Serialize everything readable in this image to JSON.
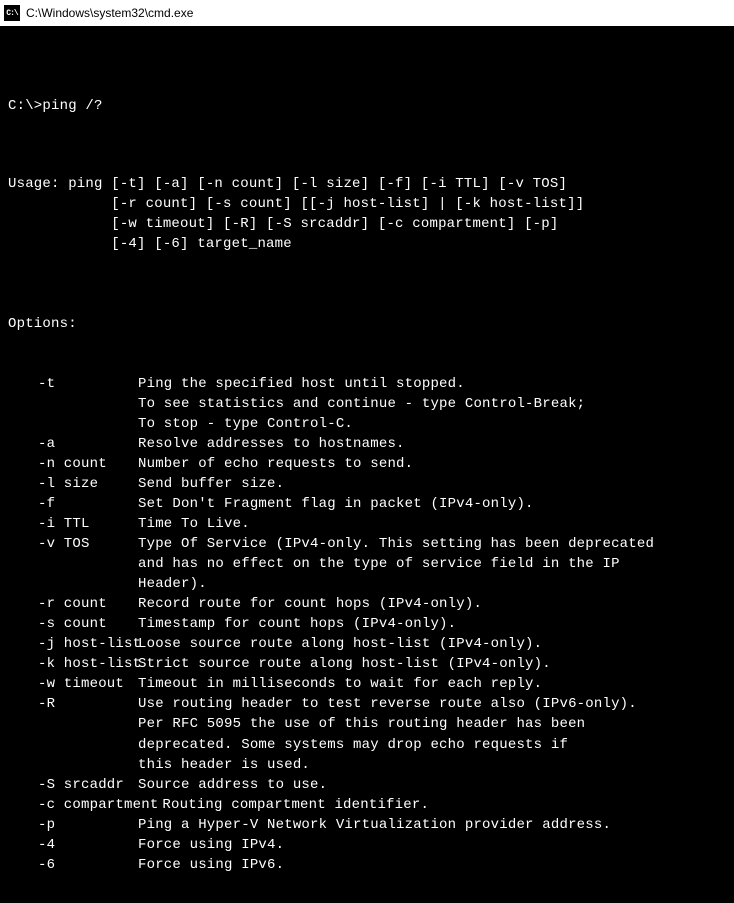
{
  "titlebar": {
    "icon_label": "C:\\",
    "title": "C:\\Windows\\system32\\cmd.exe"
  },
  "prompt": {
    "text": "C:\\>ping /?"
  },
  "usage": {
    "line1": "Usage: ping [-t] [-a] [-n count] [-l size] [-f] [-i TTL] [-v TOS]",
    "line2": "            [-r count] [-s count] [[-j host-list] | [-k host-list]]",
    "line3": "            [-w timeout] [-R] [-S srcaddr] [-c compartment] [-p]",
    "line4": "            [-4] [-6] target_name"
  },
  "options_label": "Options:",
  "options": [
    {
      "flag": "-t",
      "desc": "Ping the specified host until stopped.\nTo see statistics and continue - type Control-Break;\nTo stop - type Control-C."
    },
    {
      "flag": "-a",
      "desc": "Resolve addresses to hostnames."
    },
    {
      "flag": "-n count",
      "desc": "Number of echo requests to send."
    },
    {
      "flag": "-l size",
      "desc": "Send buffer size."
    },
    {
      "flag": "-f",
      "desc": "Set Don't Fragment flag in packet (IPv4-only)."
    },
    {
      "flag": "-i TTL",
      "desc": "Time To Live."
    },
    {
      "flag": "-v TOS",
      "desc": "Type Of Service (IPv4-only. This setting has been deprecated\nand has no effect on the type of service field in the IP\nHeader)."
    },
    {
      "flag": "-r count",
      "desc": "Record route for count hops (IPv4-only)."
    },
    {
      "flag": "-s count",
      "desc": "Timestamp for count hops (IPv4-only)."
    },
    {
      "flag": "-j host-list",
      "desc": "Loose source route along host-list (IPv4-only)."
    },
    {
      "flag": "-k host-list",
      "desc": "Strict source route along host-list (IPv4-only)."
    },
    {
      "flag": "-w timeout",
      "desc": "Timeout in milliseconds to wait for each reply."
    },
    {
      "flag": "-R",
      "desc": "Use routing header to test reverse route also (IPv6-only).\nPer RFC 5095 the use of this routing header has been\ndeprecated. Some systems may drop echo requests if\nthis header is used."
    },
    {
      "flag": "-S srcaddr",
      "desc": "Source address to use."
    },
    {
      "flag": "-c compartment",
      "desc": "Routing compartment identifier."
    },
    {
      "flag": "-p",
      "desc": "Ping a Hyper-V Network Virtualization provider address."
    },
    {
      "flag": "-4",
      "desc": "Force using IPv4."
    },
    {
      "flag": "-6",
      "desc": "Force using IPv6."
    }
  ]
}
